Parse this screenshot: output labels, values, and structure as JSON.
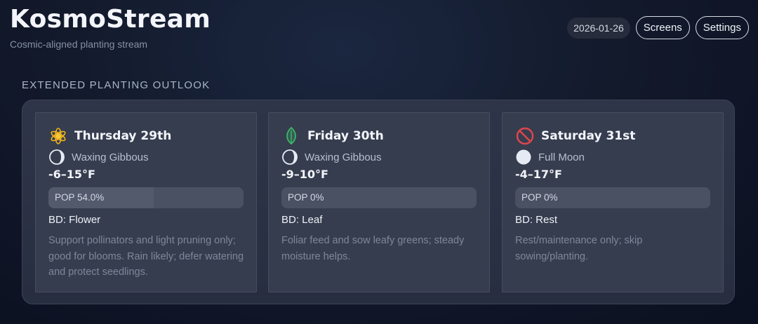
{
  "header": {
    "title": "KosmoStream",
    "subtitle": "Cosmic-aligned planting stream"
  },
  "toolbar": {
    "date": "2026-01-26",
    "screens_label": "Screens",
    "settings_label": "Settings"
  },
  "section": {
    "title": "EXTENDED PLANTING OUTLOOK"
  },
  "days": [
    {
      "day_label": "Thursday 29th",
      "icon": "flower-icon",
      "moon_phase": "Waxing Gibbous",
      "moon_icon": "waxing-gibbous-icon",
      "temp": "-6–15°F",
      "pop_label": "POP 54.0%",
      "pop_value": 54.0,
      "bd": "BD: Flower",
      "description": "Support pollinators and light pruning only; good for blooms. Rain likely; defer watering and protect seedlings."
    },
    {
      "day_label": "Friday 30th",
      "icon": "leaf-icon",
      "moon_phase": "Waxing Gibbous",
      "moon_icon": "waxing-gibbous-icon",
      "temp": "-9–10°F",
      "pop_label": "POP 0%",
      "pop_value": 0,
      "bd": "BD: Leaf",
      "description": "Foliar feed and sow leafy greens; steady moisture helps."
    },
    {
      "day_label": "Saturday 31st",
      "icon": "no-entry-icon",
      "moon_phase": "Full Moon",
      "moon_icon": "full-moon-icon",
      "temp": "-4–17°F",
      "pop_label": "POP 0%",
      "pop_value": 0,
      "bd": "BD: Rest",
      "description": "Rest/maintenance only; skip sowing/planting."
    }
  ],
  "colors": {
    "flower": "#f2b51c",
    "leaf": "#3fbf6a",
    "no_entry": "#e0474c",
    "moon": "#e6ebf3"
  }
}
